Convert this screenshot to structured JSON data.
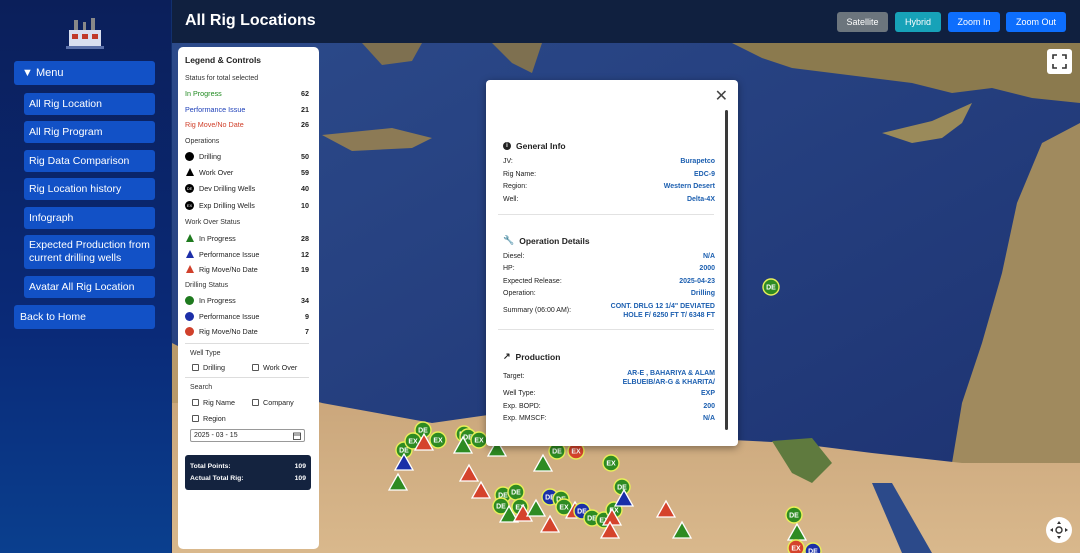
{
  "header": {
    "title": "All Rig Locations",
    "buttons": {
      "satellite": "Satellite",
      "hybrid": "Hybrid",
      "zoom_in": "Zoom In",
      "zoom_out": "Zoom Out"
    }
  },
  "sidebar": {
    "menu_label": "▼ Menu",
    "items": [
      {
        "label": "All Rig Location"
      },
      {
        "label": "All Rig Program"
      },
      {
        "label": "Rig Data Comparison"
      },
      {
        "label": "Rig Location history"
      },
      {
        "label": "Infograph"
      },
      {
        "label": "Expected Production from current drilling wells"
      },
      {
        "label": "Avatar All Rig Location"
      }
    ],
    "back_label": "Back to Home"
  },
  "legend": {
    "title": "Legend & Controls",
    "status_heading": "Status for total selected",
    "status": [
      {
        "label": "In Progress",
        "count": "62",
        "color": "#1f8a1f"
      },
      {
        "label": "Performance Issue",
        "count": "21",
        "color": "#1d3fb8"
      },
      {
        "label": "Rig Move/No Date",
        "count": "26",
        "color": "#d0402b"
      }
    ],
    "operations_heading": "Operations",
    "operations": [
      {
        "label": "Drilling",
        "count": "50",
        "icon": "circle"
      },
      {
        "label": "Work Over",
        "count": "59",
        "icon": "triangle"
      },
      {
        "label": "Dev Drilling Wells",
        "count": "40",
        "icon": "DE"
      },
      {
        "label": "Exp Drilling Wells",
        "count": "10",
        "icon": "EX"
      }
    ],
    "workover_heading": "Work Over Status",
    "workover": [
      {
        "label": "In Progress",
        "count": "28",
        "color": "#1f7a1f"
      },
      {
        "label": "Performance Issue",
        "count": "12",
        "color": "#1d2fa8"
      },
      {
        "label": "Rig Move/No Date",
        "count": "19",
        "color": "#d0402b"
      }
    ],
    "drilling_heading": "Drilling Status",
    "drilling": [
      {
        "label": "In Progress",
        "count": "34",
        "color": "#1f7a1f"
      },
      {
        "label": "Performance Issue",
        "count": "9",
        "color": "#1d2fa8"
      },
      {
        "label": "Rig Move/No Date",
        "count": "7",
        "color": "#d0402b"
      }
    ],
    "well_type_heading": "Well Type",
    "well_type_options": [
      "Drilling",
      "Work Over"
    ],
    "search_heading": "Search",
    "search_options": [
      "Rig Name",
      "Company",
      "Region"
    ],
    "date_value": "2025 - 03 - 15",
    "totals": [
      {
        "label": "Total Points:",
        "value": "109"
      },
      {
        "label": "Actual Total Rig:",
        "value": "109"
      }
    ]
  },
  "popup": {
    "general_title": "General Info",
    "general": [
      {
        "k": "JV:",
        "v": "Burapetco"
      },
      {
        "k": "Rig Name:",
        "v": "EDC-9"
      },
      {
        "k": "Region:",
        "v": "Western Desert"
      },
      {
        "k": "Well:",
        "v": "Delta-4X"
      }
    ],
    "operation_title": "Operation Details",
    "operation": [
      {
        "k": "Diesel:",
        "v": "N/A"
      },
      {
        "k": "HP:",
        "v": "2000"
      },
      {
        "k": "Expected Release:",
        "v": "2025-04-23"
      },
      {
        "k": "Operation:",
        "v": "Drilling"
      },
      {
        "k": "Summary (06:00 AM):",
        "v": "CONT. DRLG 12 1/4\" DEVIATED HOLE F/ 6250 FT T/ 6348 FT"
      }
    ],
    "production_title": "Production",
    "production": [
      {
        "k": "Target:",
        "v": "AR-E , BAHARIYA & ALAM ELBUEIB/AR-G & KHARITA/"
      },
      {
        "k": "Well Type:",
        "v": "EXP"
      },
      {
        "k": "Exp. BOPD:",
        "v": "200"
      },
      {
        "k": "Exp. MMSCF:",
        "v": "N/A"
      }
    ]
  },
  "map_markers": {
    "de": "DE",
    "ex": "EX"
  }
}
